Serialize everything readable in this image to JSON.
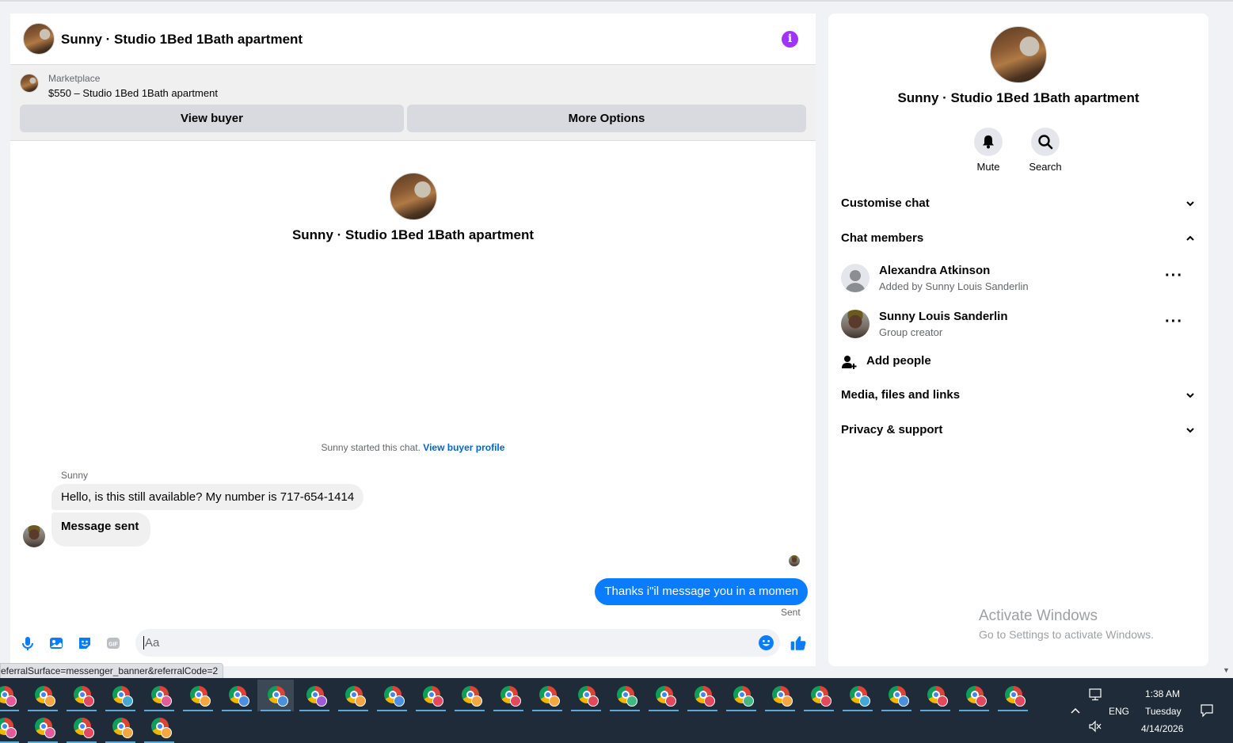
{
  "chat": {
    "title": "Sunny · Studio 1Bed 1Bath apartment",
    "marketplace_label": "Marketplace",
    "marketplace_item": "$550 – Studio 1Bed 1Bath apartment",
    "view_buyer_label": "View buyer",
    "more_options_label": "More Options",
    "intro_title": "Sunny · Studio 1Bed 1Bath apartment",
    "started_text": "Sunny started this chat.",
    "view_profile_link": "View buyer profile",
    "sender_name": "Sunny",
    "messages_in": [
      "Hello, is this still available? My number is 717-654-1414",
      "Message sent"
    ],
    "message_out": "Thanks i\"il message you in a momen",
    "sent_status": "Sent",
    "composer_placeholder": "Aa",
    "composer_icons": [
      "microphone-icon",
      "image-icon",
      "sticker-icon",
      "gif-icon",
      "emoji-icon",
      "thumbs-up-icon"
    ],
    "gif_label": "GIF"
  },
  "info": {
    "title": "Sunny · Studio 1Bed 1Bath apartment",
    "mute_label": "Mute",
    "search_label": "Search",
    "sections": {
      "customise": "Customise chat",
      "members": "Chat members",
      "media": "Media, files and links",
      "privacy": "Privacy & support"
    },
    "members": [
      {
        "name": "Alexandra Atkinson",
        "sub": "Added by Sunny Louis Sanderlin"
      },
      {
        "name": "Sunny Louis Sanderlin",
        "sub": "Group creator"
      }
    ],
    "add_people": "Add people",
    "watermark_title": "Activate Windows",
    "watermark_sub": "Go to Settings to activate Windows."
  },
  "status_url": "eferralSurface=messenger_banner&referralCode=2",
  "taskbar": {
    "time": "1:38 AM",
    "day": "Tuesday",
    "date": "4/14/2026",
    "lang": "ENG",
    "badge_colors_row1": [
      "#e45b9c",
      "#f4a640",
      "#e4485c",
      "#43a8d8",
      "#e45b9c",
      "#f4a640",
      "#4a8fe0",
      "#4a8fe0",
      "#9d5cd6",
      "#f4a640",
      "#4a8fe0",
      "#e4485c",
      "#f4a640",
      "#e4485c",
      "#f4a640",
      "#e4485c",
      "#43b884",
      "#e4485c",
      "#e4485c",
      "#43b884",
      "#f4a640",
      "#e4485c",
      "#43a8d8",
      "#4a8fe0",
      "#e4485c",
      "#e4485c",
      "#e4485c"
    ],
    "badge_colors_row2": [
      "#e45b9c",
      "#e45b9c",
      "#e4485c",
      "#f4a640",
      "#f4a640"
    ],
    "accent": "#0a7cff",
    "info_accent": "#a033ff"
  }
}
